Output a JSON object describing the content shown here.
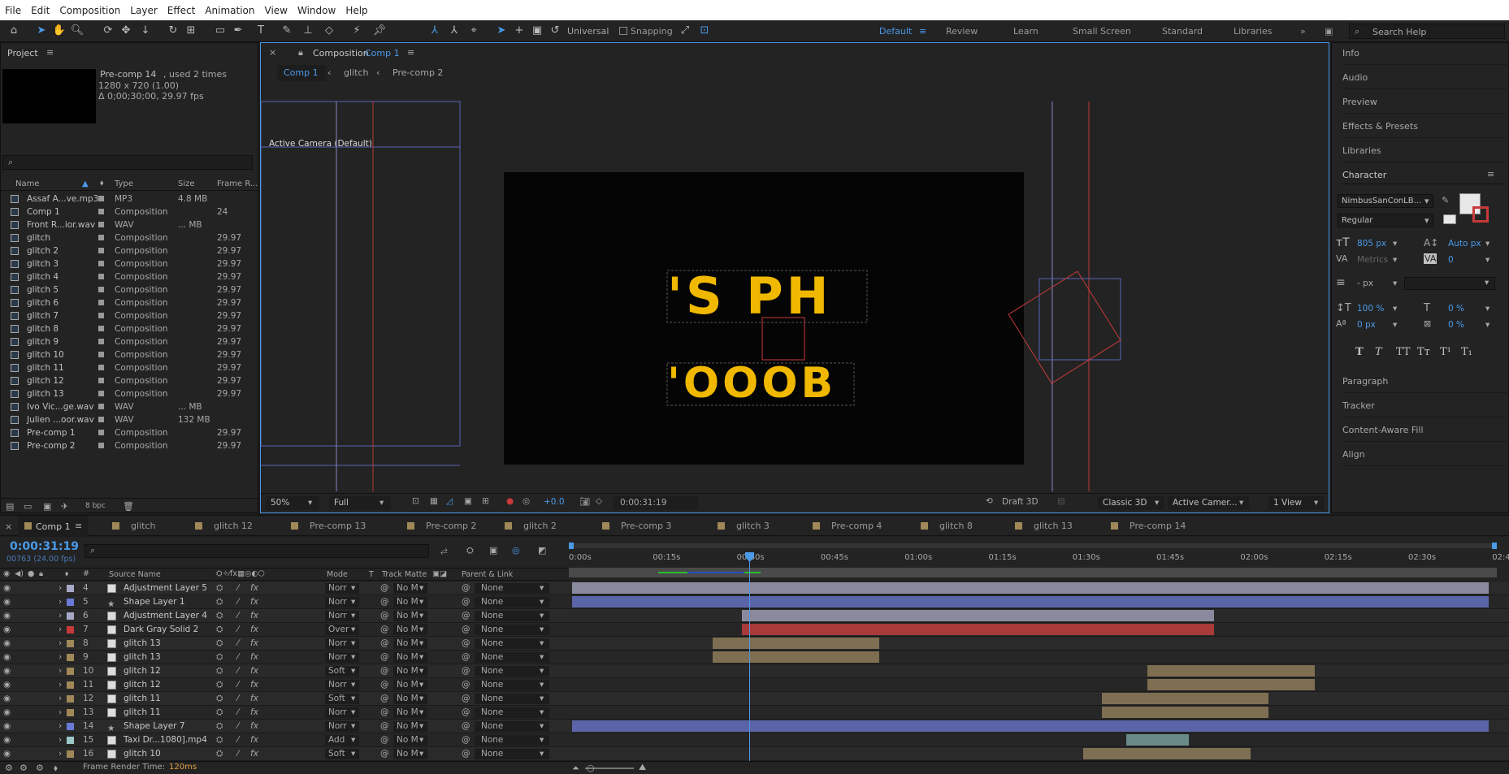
{
  "menu": [
    "File",
    "Edit",
    "Composition",
    "Layer",
    "Effect",
    "Animation",
    "View",
    "Window",
    "Help"
  ],
  "toolbar": {
    "universal": "Universal",
    "snapping": "Snapping"
  },
  "workspaces": [
    "Default",
    "Review",
    "Learn",
    "Small Screen",
    "Standard",
    "Libraries"
  ],
  "search_help": "Search Help",
  "project": {
    "title": "Project",
    "thumb_name": "Pre-comp 14",
    "thumb_used": ", used 2 times",
    "thumb_res": "1280 x 720 (1.00)",
    "thumb_dur": "Δ 0;00;30;00, 29.97 fps",
    "headers": {
      "name": "Name",
      "type": "Type",
      "size": "Size",
      "frame": "Frame R..."
    },
    "items": [
      {
        "name": "Assaf A...ve.mp3",
        "type": "MP3",
        "size": "4.8 MB",
        "fr": ""
      },
      {
        "name": "Comp 1",
        "type": "Composition",
        "size": "",
        "fr": "24"
      },
      {
        "name": "Front R...ior.wav",
        "type": "WAV",
        "size": "... MB",
        "fr": ""
      },
      {
        "name": "glitch",
        "type": "Composition",
        "size": "",
        "fr": "29.97"
      },
      {
        "name": "glitch 2",
        "type": "Composition",
        "size": "",
        "fr": "29.97"
      },
      {
        "name": "glitch 3",
        "type": "Composition",
        "size": "",
        "fr": "29.97"
      },
      {
        "name": "glitch 4",
        "type": "Composition",
        "size": "",
        "fr": "29.97"
      },
      {
        "name": "glitch 5",
        "type": "Composition",
        "size": "",
        "fr": "29.97"
      },
      {
        "name": "glitch 6",
        "type": "Composition",
        "size": "",
        "fr": "29.97"
      },
      {
        "name": "glitch 7",
        "type": "Composition",
        "size": "",
        "fr": "29.97"
      },
      {
        "name": "glitch 8",
        "type": "Composition",
        "size": "",
        "fr": "29.97"
      },
      {
        "name": "glitch 9",
        "type": "Composition",
        "size": "",
        "fr": "29.97"
      },
      {
        "name": "glitch 10",
        "type": "Composition",
        "size": "",
        "fr": "29.97"
      },
      {
        "name": "glitch 11",
        "type": "Composition",
        "size": "",
        "fr": "29.97"
      },
      {
        "name": "glitch 12",
        "type": "Composition",
        "size": "",
        "fr": "29.97"
      },
      {
        "name": "glitch 13",
        "type": "Composition",
        "size": "",
        "fr": "29.97"
      },
      {
        "name": "Ivo Vic...ge.wav",
        "type": "WAV",
        "size": "... MB",
        "fr": ""
      },
      {
        "name": "Julien ...oor.wav",
        "type": "WAV",
        "size": "132 MB",
        "fr": ""
      },
      {
        "name": "Pre-comp 1",
        "type": "Composition",
        "size": "",
        "fr": "29.97"
      },
      {
        "name": "Pre-comp 2",
        "type": "Composition",
        "size": "",
        "fr": "29.97"
      }
    ],
    "bpc": "8 bpc"
  },
  "comp": {
    "panel_label": "Composition",
    "panel_comp": "Comp 1",
    "crumbs": [
      "Comp 1",
      "glitch",
      "Pre-comp 2"
    ],
    "camera": "Active Camera (Default)",
    "zoom": "50%",
    "res": "Full",
    "exposure": "+0.0",
    "timecode": "0:00:31:19",
    "renderer": "Draft 3D",
    "classic": "Classic 3D",
    "view_cam": "Active Camer...",
    "views": "1 View",
    "text_top": "'S PH",
    "text_bottom": "'OOOB"
  },
  "right": {
    "items_top": [
      "Info",
      "Audio",
      "Preview",
      "Effects & Presets",
      "Libraries"
    ],
    "character": "Character",
    "font": "NimbusSanConLB...",
    "style": "Regular",
    "size": "805 px",
    "leading": "Auto px",
    "kerning": "Metrics",
    "tracking": "0",
    "stroke": "- px",
    "vscale": "100 %",
    "hscale": "0 %",
    "baseline": "0 px",
    "tsume": "0 %",
    "items_bottom": [
      "Paragraph",
      "Tracker",
      "Content-Aware Fill",
      "Align"
    ]
  },
  "timeline": {
    "tabs": [
      "Comp 1",
      "glitch",
      "glitch 12",
      "Pre-comp 13",
      "Pre-comp 2",
      "glitch 2",
      "Pre-comp 3",
      "glitch 3",
      "Pre-comp 4",
      "glitch 8",
      "glitch 13",
      "Pre-comp 14"
    ],
    "timecode": "0:00:31:19",
    "frames": "00763 (24.00 fps)",
    "headers": {
      "source": "Source Name",
      "mode": "Mode",
      "t": "T",
      "matte": "Track Matte",
      "parent": "Parent & Link"
    },
    "ruler": [
      "0:00s",
      "00:15s",
      "00:30s",
      "00:45s",
      "01:00s",
      "01:15s",
      "01:30s",
      "01:45s",
      "02:00s",
      "02:15s",
      "02:30s",
      "02:4"
    ],
    "layers": [
      {
        "n": "4",
        "name": "Adjustment Layer 5",
        "color": "#a8a8c8",
        "mode": "Norr",
        "matte": "No M",
        "parent": "None",
        "bar_start": 0.0,
        "bar_end": 1.0,
        "bar_color": "#8a8a9e"
      },
      {
        "n": "5",
        "name": "Shape Layer 1",
        "color": "#6a7ad8",
        "mode": "Norr",
        "matte": "No M",
        "parent": "None",
        "bar_start": 0.0,
        "bar_end": 1.0,
        "bar_color": "#5a64a8"
      },
      {
        "n": "6",
        "name": "Adjustment Layer 4",
        "color": "#a8a8c8",
        "mode": "Norr",
        "matte": "No M",
        "parent": "None",
        "bar_start": 0.185,
        "bar_end": 0.7,
        "bar_color": "#8a8a9e"
      },
      {
        "n": "7",
        "name": "Dark Gray Solid 2",
        "color": "#c83a3a",
        "mode": "Over",
        "matte": "No M",
        "parent": "None",
        "bar_start": 0.185,
        "bar_end": 0.7,
        "bar_color": "#a83a3a"
      },
      {
        "n": "8",
        "name": "glitch 13",
        "color": "#a08858",
        "mode": "Norr",
        "matte": "No M",
        "parent": "None",
        "bar_start": 0.153,
        "bar_end": 0.335,
        "bar_color": "#7e6e52"
      },
      {
        "n": "9",
        "name": "glitch 13",
        "color": "#a08858",
        "mode": "Norr",
        "matte": "No M",
        "parent": "None",
        "bar_start": 0.153,
        "bar_end": 0.335,
        "bar_color": "#7e6e52"
      },
      {
        "n": "10",
        "name": "glitch 12",
        "color": "#a08858",
        "mode": "Soft",
        "matte": "No M",
        "parent": "None",
        "bar_start": 0.628,
        "bar_end": 0.81,
        "bar_color": "#7e6e52"
      },
      {
        "n": "11",
        "name": "glitch 12",
        "color": "#a08858",
        "mode": "Norr",
        "matte": "No M",
        "parent": "None",
        "bar_start": 0.628,
        "bar_end": 0.81,
        "bar_color": "#7e6e52"
      },
      {
        "n": "12",
        "name": "glitch 11",
        "color": "#a08858",
        "mode": "Soft",
        "matte": "No M",
        "parent": "None",
        "bar_start": 0.578,
        "bar_end": 0.76,
        "bar_color": "#7e6e52"
      },
      {
        "n": "13",
        "name": "glitch 11",
        "color": "#a08858",
        "mode": "Norr",
        "matte": "No M",
        "parent": "None",
        "bar_start": 0.578,
        "bar_end": 0.76,
        "bar_color": "#7e6e52"
      },
      {
        "n": "14",
        "name": "Shape Layer 7",
        "color": "#6a7ad8",
        "mode": "Norr",
        "matte": "No M",
        "parent": "None",
        "bar_start": 0.0,
        "bar_end": 1.0,
        "bar_color": "#5a64a8"
      },
      {
        "n": "15",
        "name": "Taxi Dr...1080].mp4",
        "color": "#9ec8c8",
        "mode": "Add",
        "matte": "No M",
        "parent": "None",
        "bar_start": 0.605,
        "bar_end": 0.673,
        "bar_color": "#6a8a8a"
      },
      {
        "n": "16",
        "name": "glitch 10",
        "color": "#a08858",
        "mode": "Soft",
        "matte": "No M",
        "parent": "None",
        "bar_start": 0.558,
        "bar_end": 0.74,
        "bar_color": "#7e6e52"
      }
    ],
    "render_time_label": "Frame Render Time:",
    "render_time": "120ms"
  }
}
